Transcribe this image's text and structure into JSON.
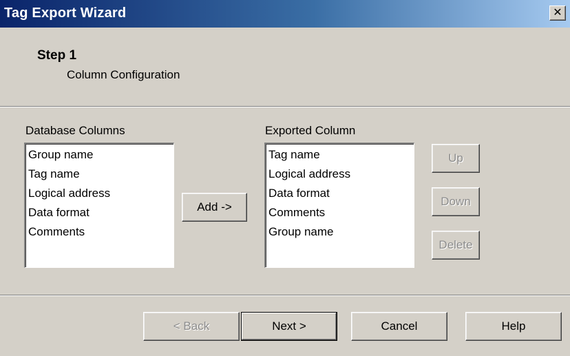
{
  "window": {
    "title": "Tag Export Wizard",
    "close_label": "✕"
  },
  "step": {
    "title": "Step 1",
    "subtitle": "Column Configuration"
  },
  "database_columns": {
    "label": "Database Columns",
    "items": [
      "Group name",
      "Tag name",
      "Logical address",
      "Data format",
      "Comments"
    ]
  },
  "add_button": "Add ->",
  "exported_column": {
    "label": "Exported Column",
    "items": [
      "Tag name",
      "Logical address",
      "Data format",
      "Comments",
      "Group name"
    ]
  },
  "side_buttons": {
    "up": "Up",
    "down": "Down",
    "delete": "Delete"
  },
  "footer": {
    "back": "< Back",
    "next": "Next >",
    "cancel": "Cancel",
    "help": "Help"
  }
}
